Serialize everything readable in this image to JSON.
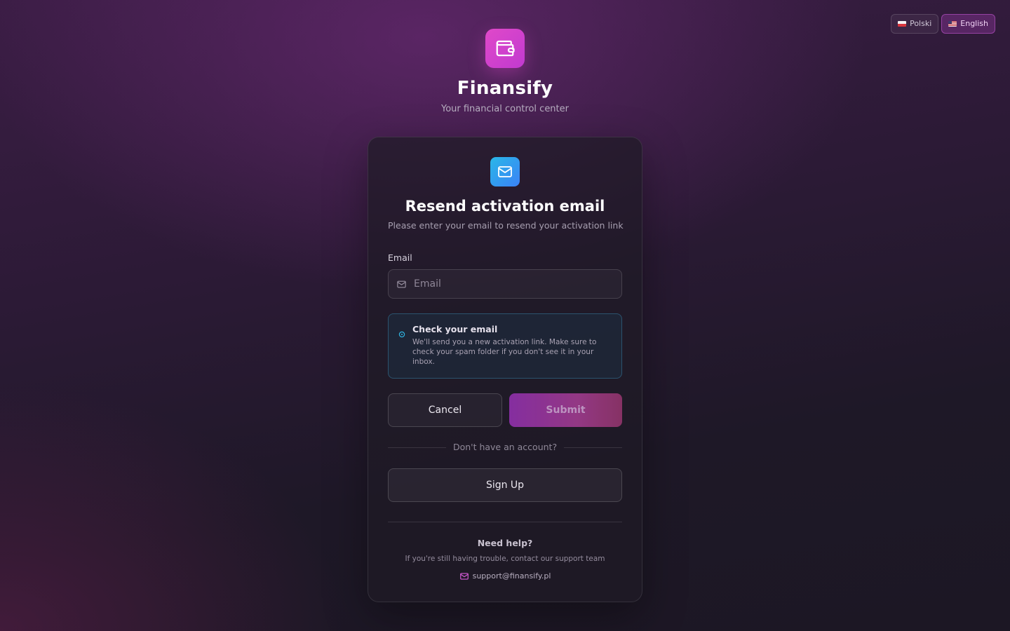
{
  "language_switch": {
    "options": [
      {
        "label": "Polski",
        "icon": "poland-flag-icon",
        "selected": false
      },
      {
        "label": "English",
        "icon": "us-flag-icon",
        "selected": true
      }
    ]
  },
  "brand": {
    "name": "Finansify",
    "tagline": "Your financial control center",
    "logo_icon": "wallet-icon",
    "accent_color": "#d946c8"
  },
  "card": {
    "icon": "mail-icon",
    "title": "Resend activation email",
    "subtitle": "Please enter your email to resend your activation link",
    "email_field": {
      "label": "Email",
      "placeholder": "Email",
      "value": "",
      "icon": "mail-icon"
    },
    "info": {
      "icon": "info-icon",
      "title": "Check your email",
      "text": "We'll send you a new activation link. Make sure to check your spam folder if you don't see it in your inbox."
    },
    "buttons": {
      "cancel": "Cancel",
      "submit": "Submit"
    },
    "divider_text": "Don't have an account?",
    "signup_button": "Sign Up",
    "help": {
      "title": "Need help?",
      "text": "If you're still having trouble, contact our support team",
      "email": "support@finansify.pl",
      "email_icon": "mail-icon"
    }
  }
}
